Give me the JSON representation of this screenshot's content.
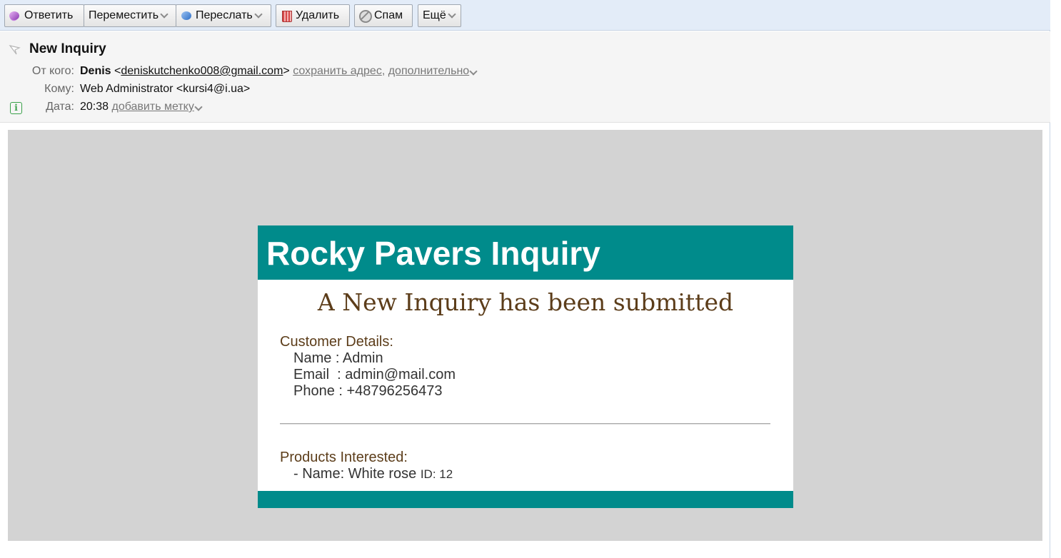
{
  "toolbar": {
    "reply": "Ответить",
    "move": "Переместить",
    "forward": "Переслать",
    "delete": "Удалить",
    "spam": "Спам",
    "more": "Ещё"
  },
  "header": {
    "subject": "New Inquiry",
    "from_label": "От кого:",
    "from_name": "Denis",
    "from_email": "deniskutchenko008@gmail.com",
    "save_address": "сохранить адрес",
    "details": "дополнительно",
    "to_label": "Кому:",
    "to_value": "Web Administrator <kursi4@i.ua>",
    "date_label": "Дата:",
    "date_value": "20:38",
    "add_label": "добавить метку"
  },
  "email": {
    "title": "Rocky Pavers Inquiry",
    "subtitle": "A New Inquiry has been submitted",
    "customer_heading": "Customer Details:",
    "name_line": "Name : Admin",
    "email_line": "Email  : admin@mail.com",
    "phone_line": "Phone : +48796256473",
    "products_heading": "Products Interested:",
    "product_prefix": "- Name: White rose",
    "product_id": "ID: 12",
    "accent_color": "#008b8b",
    "text_color": "#5c3d1a"
  }
}
